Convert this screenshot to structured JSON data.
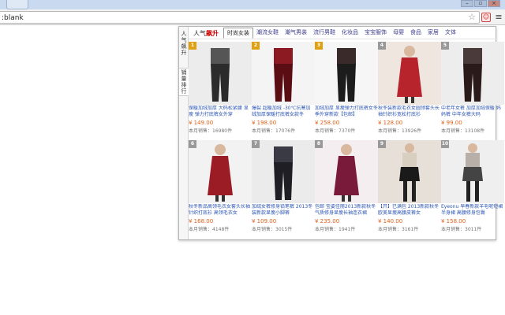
{
  "browser": {
    "address": ":blank",
    "star_icon": "star-icon",
    "window_controls": [
      "–",
      "▫",
      "×"
    ],
    "ext_icon_glyph": "☺",
    "menu_glyph": "≡"
  },
  "popup": {
    "logo_prefix": "人气",
    "logo_suffix": "飙升",
    "sidebar": [
      {
        "label": "人气飙升"
      },
      {
        "label": "销量排行"
      }
    ],
    "categories": [
      "时尚女装",
      "潮流女鞋",
      "潮气男装",
      "流行男鞋",
      "化妆品",
      "宝宝服饰",
      "母婴",
      "食品",
      "家居",
      "文体"
    ],
    "active_category_index": 0,
    "products": [
      {
        "rank": "1",
        "title": "保暖加绒加厚 大码松紧腰 显瘦 弹力打底裤女外穿",
        "price": "¥ 149.00",
        "sales": "本月销售：16980件"
      },
      {
        "rank": "2",
        "title": "爆裂 超暖加绒 -30℃抗寒加绒加厚保暖打底裤女款冬",
        "price": "¥ 198.00",
        "sales": "本月销售：17076件"
      },
      {
        "rank": "3",
        "title": "加绒加厚 显瘦弹力打底裤女冬季外穿新款【包邮】",
        "price": "¥ 258.00",
        "sales": "本月销售：7370件"
      },
      {
        "rank": "4",
        "title": "秋冬装新款毛衣女圆领套头长袖针织衫宽松打底衫",
        "price": "¥ 128.00",
        "sales": "本月销售：13926件"
      },
      {
        "rank": "5",
        "title": "中老年女裤 加厚加绒保暖 妈妈裤 中年女裤大码",
        "price": "¥ 99.00",
        "sales": "本月销售：13108件"
      },
      {
        "rank": "6",
        "title": "秋冬新品高领毛衣女套头长袖针织打底衫 高领毛衣女",
        "price": "¥ 168.00",
        "sales": "本月销售：4148件"
      },
      {
        "rank": "7",
        "title": "加绒女裤修身铅笔裤 2013冬装新款显瘦小脚裤",
        "price": "¥ 109.00",
        "sales": "本月销售：3015件"
      },
      {
        "rank": "8",
        "title": "包邮 宝姿佳丽2013新款秋冬气质修身显瘦长袖连衣裙",
        "price": "¥ 235.00",
        "sales": "本月销售：1941件"
      },
      {
        "rank": "9",
        "title": "【开】已满包 2013新款秋冬 欧美显瘦高腰皮裤女",
        "price": "¥ 140.00",
        "sales": "本月销售：3161件"
      },
      {
        "rank": "10",
        "title": "Eyeonu 早春新款羊毛呢短裙半身裙 高腰修身包臀",
        "price": "¥ 158.00",
        "sales": "本月销售：3011件"
      }
    ]
  },
  "colors": {
    "badge_top": "#e0a010",
    "badge_rest": "#999999",
    "price": "#e0601a",
    "link": "#2a55b0"
  }
}
